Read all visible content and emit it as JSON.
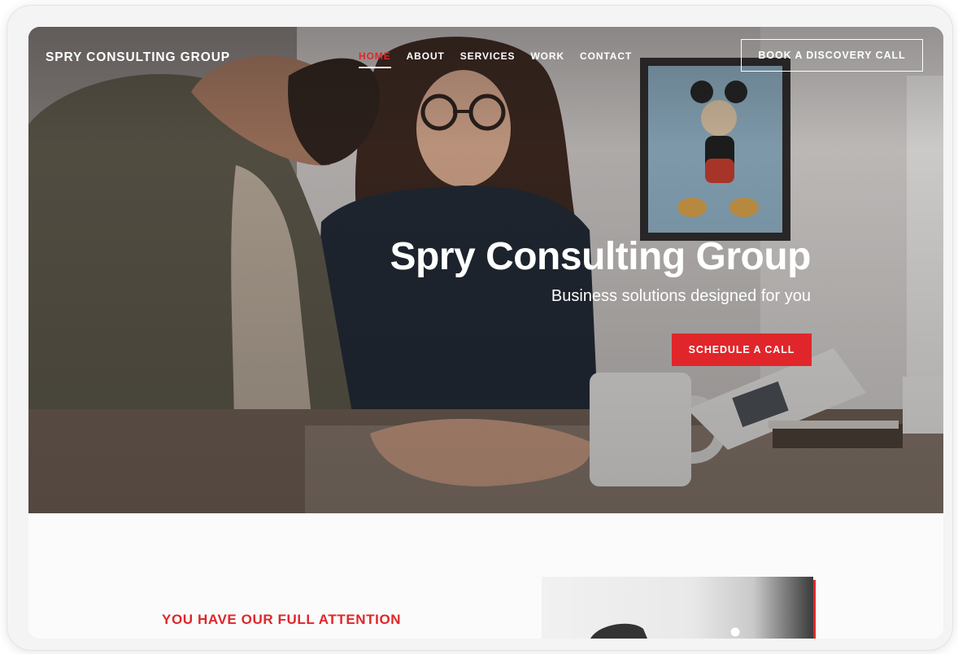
{
  "header": {
    "brand": "SPRY CONSULTING GROUP",
    "nav": [
      {
        "label": "HOME",
        "active": true
      },
      {
        "label": "ABOUT",
        "active": false
      },
      {
        "label": "SERVICES",
        "active": false
      },
      {
        "label": "WORK",
        "active": false
      },
      {
        "label": "CONTACT",
        "active": false
      }
    ],
    "book_button": "BOOK A DISCOVERY CALL"
  },
  "hero": {
    "title": "Spry Consulting Group",
    "subtitle": "Business solutions designed for you",
    "cta": "SCHEDULE A CALL"
  },
  "section": {
    "heading": "YOU HAVE OUR FULL ATTENTION"
  },
  "colors": {
    "accent": "#e0262a",
    "text_light": "#ffffff",
    "page_bg": "#fbfbfb"
  }
}
